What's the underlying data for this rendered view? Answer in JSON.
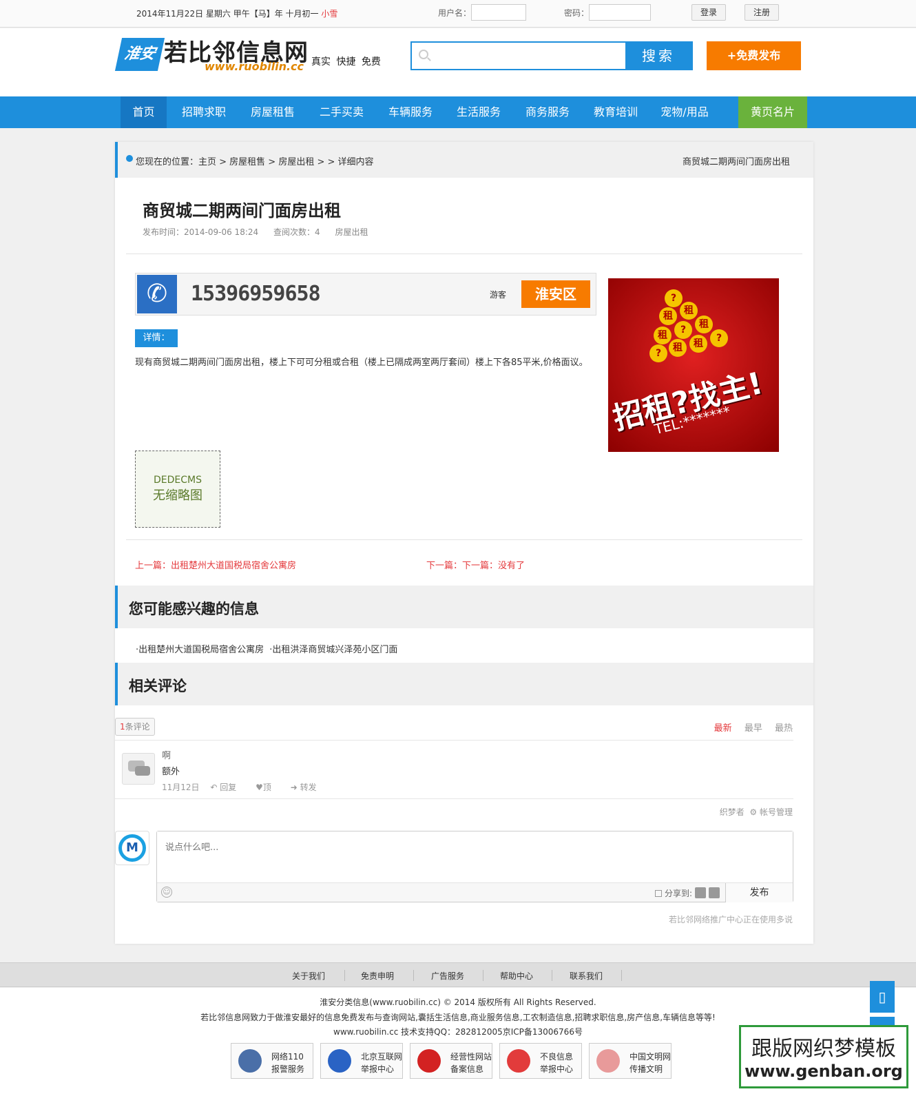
{
  "topbar": {
    "date_text": "2014年11月22日 星期六  甲午【马】年 十月初一 ",
    "weather": "小雪",
    "username_label": "用户名：",
    "password_label": "密码：",
    "login_label": "登录",
    "register_label": "注册"
  },
  "header": {
    "logo_badge": "淮安",
    "logo_name": "若比邻信息网",
    "logo_url": "www.ruobilin.cc",
    "slogan": "真实 快捷 免费",
    "search_placeholder": "",
    "search_button": "搜索",
    "publish_button": "+免费发布"
  },
  "nav": {
    "items": [
      "首页",
      "招聘求职",
      "房屋租售",
      "二手买卖",
      "车辆服务",
      "生活服务",
      "商务服务",
      "教育培训",
      "宠物/用品",
      "黄页名片"
    ]
  },
  "breadcrumb": {
    "path": "您现在的位置：主页 > 房屋租售 > 房屋出租 > > 详细内容",
    "right_title": "商贸城二期两间门面房出租"
  },
  "article": {
    "title": "商贸城二期两间门面房出租",
    "publish_time": "发布时间：2014-09-06 18:24",
    "views": "查阅次数：4",
    "category": "房屋出租",
    "phone": "15396959658",
    "user_type": "游客",
    "area": "淮安区",
    "detail_label": "详情：",
    "detail_text": "现有商贸城二期两间门面房出租，楼上下可可分租或合租（楼上已隔成两室两厅套间）楼上下各85平米,价格面议。",
    "thumb_line1": "DEDECMS",
    "thumb_line2": "无缩略图",
    "ad_big": "招租?找主!",
    "ad_tel": "TEL:*******",
    "ad_coin": "租",
    "ad_q": "?",
    "prev": "上一篇：出租楚州大道国税局宿舍公寓房",
    "next": "下一篇：下一篇：没有了"
  },
  "related": {
    "heading": "您可能感兴趣的信息",
    "items": [
      "·出租楚州大道国税局宿舍公寓房",
      "·出租洪泽商贸城兴泽苑小区门面"
    ]
  },
  "comments": {
    "heading": "相关评论",
    "count_num": "1",
    "count_label": "条评论",
    "sort_latest": "最新",
    "sort_earliest": "最早",
    "sort_hottest": "最热",
    "item": {
      "name": "啊",
      "text": "额外",
      "date": "11月12日",
      "reply": "回复",
      "up": "顶",
      "forward": "转发"
    },
    "account_user": "织梦者",
    "account_manage": "帐号管理",
    "avatar_letter": "M",
    "placeholder": "说点什么吧...",
    "share_label": "分享到:",
    "send_label": "发布",
    "powered": "若比邻网络推广中心正在使用多说"
  },
  "footer": {
    "nav": [
      "关于我们",
      "免责申明",
      "广告服务",
      "帮助中心",
      "联系我们"
    ],
    "line1": "淮安分类信息(www.ruobilin.cc) © 2014 版权所有 All Rights Reserved.",
    "line2": "若比邻信息网致力于做淮安最好的信息免费发布与查询网站,囊括生活信息,商业服务信息,工农制造信息,招聘求职信息,房产信息,车辆信息等等!",
    "line3": "www.ruobilin.cc 技术支持QQ：282812005京ICP备13006766号",
    "badges": [
      {
        "l1": "网络110",
        "l2": "报警服务"
      },
      {
        "l1": "北京互联网",
        "l2": "举报中心"
      },
      {
        "l1": "经营性网站",
        "l2": "备案信息"
      },
      {
        "l1": "不良信息",
        "l2": "举报中心"
      },
      {
        "l1": "中国文明网",
        "l2": "传播文明"
      }
    ]
  },
  "watermark": {
    "line1": "跟版网织梦模板",
    "line2": "www.genban.org"
  },
  "colors": {
    "primary": "#1e8fdc",
    "orange": "#f77b00",
    "red": "#e4393c",
    "green": "#6ab23c"
  }
}
